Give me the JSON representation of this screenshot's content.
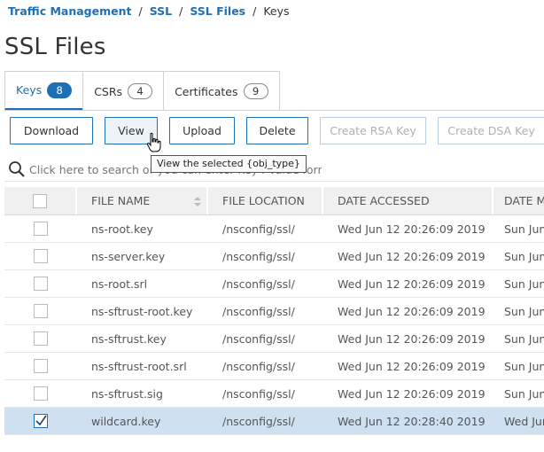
{
  "breadcrumb": {
    "items": [
      "Traffic Management",
      "SSL",
      "SSL Files"
    ],
    "current": "Keys",
    "separator": "/"
  },
  "page_title": "SSL Files",
  "tabs": [
    {
      "label": "Keys",
      "count": "8",
      "active": true
    },
    {
      "label": "CSRs",
      "count": "4",
      "active": false
    },
    {
      "label": "Certificates",
      "count": "9",
      "active": false
    }
  ],
  "toolbar": {
    "download": "Download",
    "view": "View",
    "upload": "Upload",
    "delete": "Delete",
    "create_rsa": "Create RSA Key",
    "create_dsa": "Create DSA Key"
  },
  "tooltip": "View the selected {obj_type}",
  "search": {
    "placeholder": "Click here to search or you can enter Key : Value format"
  },
  "table": {
    "columns": [
      "FILE NAME",
      "FILE LOCATION",
      "DATE ACCESSED",
      "DATE MODIFIED"
    ],
    "rows": [
      {
        "name": "ns-root.key",
        "location": "/nsconfig/ssl/",
        "accessed": "Wed Jun 12 20:26:09 2019",
        "modified": "Sun Jun",
        "selected": false
      },
      {
        "name": "ns-server.key",
        "location": "/nsconfig/ssl/",
        "accessed": "Wed Jun 12 20:26:09 2019",
        "modified": "Sun Jun",
        "selected": false
      },
      {
        "name": "ns-root.srl",
        "location": "/nsconfig/ssl/",
        "accessed": "Wed Jun 12 20:26:09 2019",
        "modified": "Sun Jun",
        "selected": false
      },
      {
        "name": "ns-sftrust-root.key",
        "location": "/nsconfig/ssl/",
        "accessed": "Wed Jun 12 20:26:09 2019",
        "modified": "Sun Jun",
        "selected": false
      },
      {
        "name": "ns-sftrust.key",
        "location": "/nsconfig/ssl/",
        "accessed": "Wed Jun 12 20:26:09 2019",
        "modified": "Sun Jun",
        "selected": false
      },
      {
        "name": "ns-sftrust-root.srl",
        "location": "/nsconfig/ssl/",
        "accessed": "Wed Jun 12 20:26:09 2019",
        "modified": "Sun Jun",
        "selected": false
      },
      {
        "name": "ns-sftrust.sig",
        "location": "/nsconfig/ssl/",
        "accessed": "Wed Jun 12 20:26:09 2019",
        "modified": "Sun Jun",
        "selected": false
      },
      {
        "name": "wildcard.key",
        "location": "/nsconfig/ssl/",
        "accessed": "Wed Jun 12 20:28:40 2019",
        "modified": "Wed Jun",
        "selected": true
      }
    ]
  },
  "colors": {
    "accent": "#1f6fb5",
    "selected_row": "#cfe0f0",
    "header_bg": "#f0f0f0"
  }
}
